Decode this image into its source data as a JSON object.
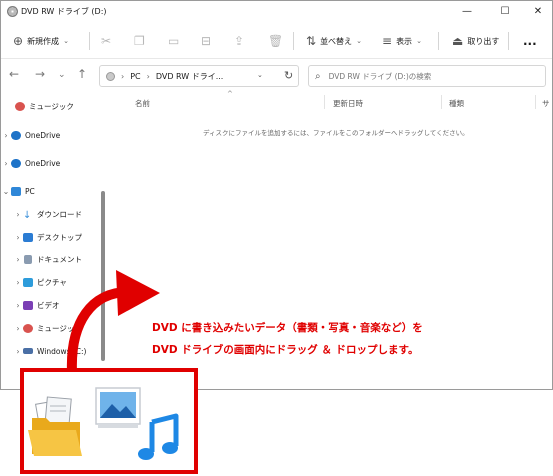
{
  "window": {
    "title": "DVD RW ドライブ (D:)",
    "minimize": "—",
    "maximize": "☐",
    "close": "✕"
  },
  "toolbar": {
    "new_label": "新規作成",
    "sort_label": "並べ替え",
    "view_label": "表示",
    "eject_label": "取り出す",
    "more_label": "..."
  },
  "nav": {
    "breadcrumb": [
      "PC",
      "DVD RW ドライ..."
    ],
    "search_placeholder": "DVD RW ドライブ (D:)の検索"
  },
  "sidebar": {
    "items": [
      {
        "label": "ミュージック",
        "icon": "music-icon",
        "color": "#d9534f",
        "chevron": ""
      },
      {
        "label": "OneDrive",
        "icon": "cloud-icon",
        "color": "#1e73c8",
        "chevron": "›"
      },
      {
        "label": "OneDrive",
        "icon": "cloud-icon",
        "color": "#1e73c8",
        "chevron": "›"
      },
      {
        "label": "PC",
        "icon": "pc-icon",
        "color": "#2f87d8",
        "chevron": "⌄"
      },
      {
        "label": "ダウンロード",
        "icon": "download-icon",
        "color": "#3a8fd9",
        "chevron": "›"
      },
      {
        "label": "デスクトップ",
        "icon": "desktop-icon",
        "color": "#2b7cd3",
        "chevron": "›"
      },
      {
        "label": "ドキュメント",
        "icon": "document-icon",
        "color": "#8a9bb0",
        "chevron": "›"
      },
      {
        "label": "ピクチャ",
        "icon": "pictures-icon",
        "color": "#2d9cdb",
        "chevron": "›"
      },
      {
        "label": "ビデオ",
        "icon": "video-icon",
        "color": "#7b3fb5",
        "chevron": "›"
      },
      {
        "label": "ミュージック",
        "icon": "music-icon",
        "color": "#d9534f",
        "chevron": "›"
      },
      {
        "label": "Windows (C:)",
        "icon": "drive-icon",
        "color": "#4a6fa5",
        "chevron": "›"
      }
    ]
  },
  "columns": {
    "name": "名前",
    "modified": "更新日時",
    "type": "種類",
    "size": "サ"
  },
  "content": {
    "empty_message": "ディスクにファイルを追加するには、ファイルをこのフォルダーへドラッグしてください。"
  },
  "instruction": {
    "line1": "DVD に書き込みたいデータ（書類・写真・音楽など）を",
    "line2": "DVD ドライブの画面内にドラッグ ＆ ドロップします。"
  },
  "colors": {
    "accent_red": "#e00000",
    "folder": "#f5c542",
    "music_blue": "#1e88e5",
    "photo_blue": "#3a86d4"
  }
}
